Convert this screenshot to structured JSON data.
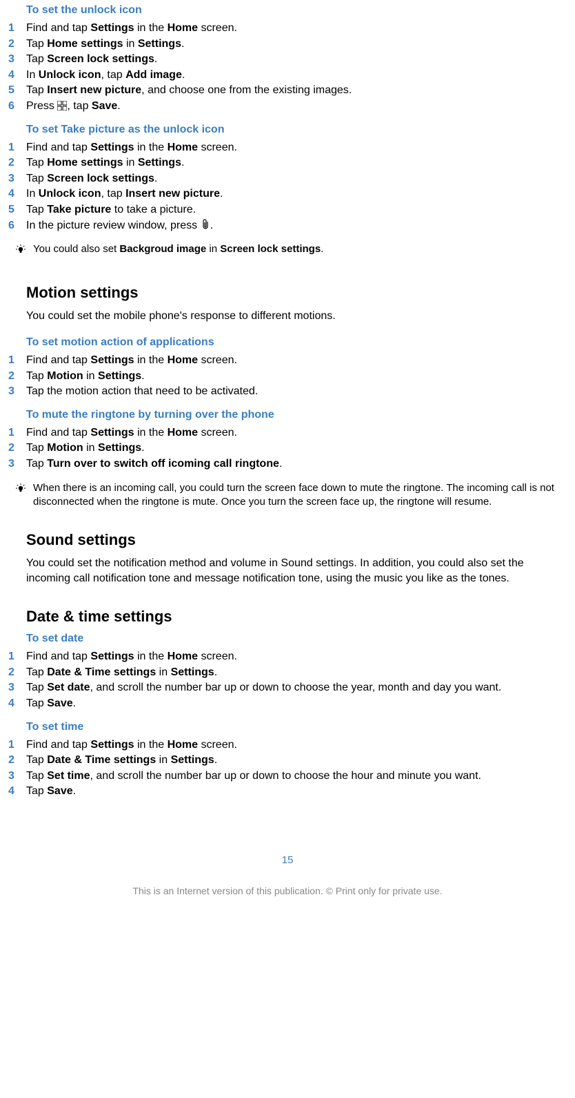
{
  "sections": [
    {
      "id": "unlock_icon",
      "sub_heading": "To set the unlock icon",
      "steps": [
        [
          {
            "t": "Find and tap "
          },
          {
            "t": "Settings",
            "b": true
          },
          {
            "t": " in the "
          },
          {
            "t": "Home",
            "b": true
          },
          {
            "t": " screen."
          }
        ],
        [
          {
            "t": "Tap "
          },
          {
            "t": "Home settings",
            "b": true
          },
          {
            "t": " in "
          },
          {
            "t": "Settings",
            "b": true
          },
          {
            "t": "."
          }
        ],
        [
          {
            "t": "Tap "
          },
          {
            "t": "Screen lock settings",
            "b": true
          },
          {
            "t": "."
          }
        ],
        [
          {
            "t": "In "
          },
          {
            "t": "Unlock icon",
            "b": true
          },
          {
            "t": ", tap "
          },
          {
            "t": "Add image",
            "b": true
          },
          {
            "t": "."
          }
        ],
        [
          {
            "t": "Tap "
          },
          {
            "t": "Insert new picture",
            "b": true
          },
          {
            "t": ", and choose one from the existing images."
          }
        ],
        [
          {
            "t": "Press "
          },
          {
            "icon": "grid"
          },
          {
            "t": ", tap "
          },
          {
            "t": "Save",
            "b": true
          },
          {
            "t": "."
          }
        ]
      ]
    },
    {
      "id": "take_picture_unlock",
      "sub_heading": "To set Take picture as the unlock icon",
      "steps": [
        [
          {
            "t": "Find and tap "
          },
          {
            "t": "Settings",
            "b": true
          },
          {
            "t": " in the "
          },
          {
            "t": "Home",
            "b": true
          },
          {
            "t": " screen."
          }
        ],
        [
          {
            "t": "Tap "
          },
          {
            "t": "Home settings",
            "b": true
          },
          {
            "t": " in "
          },
          {
            "t": "Settings",
            "b": true
          },
          {
            "t": "."
          }
        ],
        [
          {
            "t": "Tap "
          },
          {
            "t": "Screen lock settings",
            "b": true
          },
          {
            "t": "."
          }
        ],
        [
          {
            "t": "In "
          },
          {
            "t": "Unlock icon",
            "b": true
          },
          {
            "t": ", tap "
          },
          {
            "t": "Insert new picture",
            "b": true
          },
          {
            "t": "."
          }
        ],
        [
          {
            "t": "Tap "
          },
          {
            "t": "Take picture",
            "b": true
          },
          {
            "t": " to take a picture."
          }
        ],
        [
          {
            "t": "In the picture review window, press "
          },
          {
            "icon": "clip"
          },
          {
            "t": "."
          }
        ]
      ],
      "tip": [
        {
          "t": "You could also set "
        },
        {
          "t": "Backgroud image",
          "b": true
        },
        {
          "t": " in "
        },
        {
          "t": "Screen lock settings",
          "b": true
        },
        {
          "t": "."
        }
      ]
    },
    {
      "id": "motion_heading",
      "section_heading": "Motion settings",
      "para": "You could set the mobile phone's response to different motions."
    },
    {
      "id": "motion_action",
      "sub_heading": "To set motion action of applications",
      "steps": [
        [
          {
            "t": "Find and tap "
          },
          {
            "t": "Settings",
            "b": true
          },
          {
            "t": " in the "
          },
          {
            "t": "Home",
            "b": true
          },
          {
            "t": " screen."
          }
        ],
        [
          {
            "t": "Tap "
          },
          {
            "t": "Motion",
            "b": true
          },
          {
            "t": " in "
          },
          {
            "t": "Settings",
            "b": true
          },
          {
            "t": "."
          }
        ],
        [
          {
            "t": "Tap the motion action that need to be activated."
          }
        ]
      ]
    },
    {
      "id": "mute_ringtone",
      "sub_heading": "To mute the ringtone by turning over the phone",
      "steps": [
        [
          {
            "t": "Find and tap "
          },
          {
            "t": "Settings",
            "b": true
          },
          {
            "t": " in the "
          },
          {
            "t": "Home",
            "b": true
          },
          {
            "t": " screen."
          }
        ],
        [
          {
            "t": "Tap "
          },
          {
            "t": "Motion",
            "b": true
          },
          {
            "t": " in "
          },
          {
            "t": "Settings",
            "b": true
          },
          {
            "t": "."
          }
        ],
        [
          {
            "t": "Tap "
          },
          {
            "t": "Turn over to switch off icoming call ringtone",
            "b": true
          },
          {
            "t": "."
          }
        ]
      ],
      "tip": [
        {
          "t": "When there is an incoming call, you could turn the screen face down to mute the ringtone. The incoming call is not disconnected when the ringtone is mute. Once you turn the screen face up, the ringtone will resume."
        }
      ]
    },
    {
      "id": "sound_heading",
      "section_heading": "Sound settings",
      "para": "You could set the notification method and volume in Sound settings. In addition, you could also set the incoming call notification tone and message notification tone, using the music you like as the tones."
    },
    {
      "id": "datetime_heading",
      "section_heading": "Date & time settings"
    },
    {
      "id": "set_date",
      "sub_heading": "To set date",
      "steps": [
        [
          {
            "t": "Find and tap "
          },
          {
            "t": "Settings",
            "b": true
          },
          {
            "t": " in the "
          },
          {
            "t": "Home",
            "b": true
          },
          {
            "t": " screen."
          }
        ],
        [
          {
            "t": "Tap "
          },
          {
            "t": "Date & Time settings",
            "b": true
          },
          {
            "t": " in "
          },
          {
            "t": "Settings",
            "b": true
          },
          {
            "t": "."
          }
        ],
        [
          {
            "t": "Tap "
          },
          {
            "t": "Set date",
            "b": true
          },
          {
            "t": ", and scroll the number bar up or down to choose the year, month and day you want."
          }
        ],
        [
          {
            "t": "Tap "
          },
          {
            "t": "Save",
            "b": true
          },
          {
            "t": "."
          }
        ]
      ]
    },
    {
      "id": "set_time",
      "sub_heading": "To set time",
      "steps": [
        [
          {
            "t": "Find and tap "
          },
          {
            "t": "Settings",
            "b": true
          },
          {
            "t": " in the "
          },
          {
            "t": "Home",
            "b": true
          },
          {
            "t": " screen."
          }
        ],
        [
          {
            "t": "Tap "
          },
          {
            "t": "Date & Time settings",
            "b": true
          },
          {
            "t": " in "
          },
          {
            "t": "Settings",
            "b": true
          },
          {
            "t": "."
          }
        ],
        [
          {
            "t": "Tap "
          },
          {
            "t": "Set time",
            "b": true
          },
          {
            "t": ", and scroll the number bar up or down to choose the hour and minute you want."
          }
        ],
        [
          {
            "t": "Tap "
          },
          {
            "t": "Save",
            "b": true
          },
          {
            "t": "."
          }
        ]
      ]
    }
  ],
  "page_number": "15",
  "footer": "This is an Internet version of this publication. © Print only for private use."
}
